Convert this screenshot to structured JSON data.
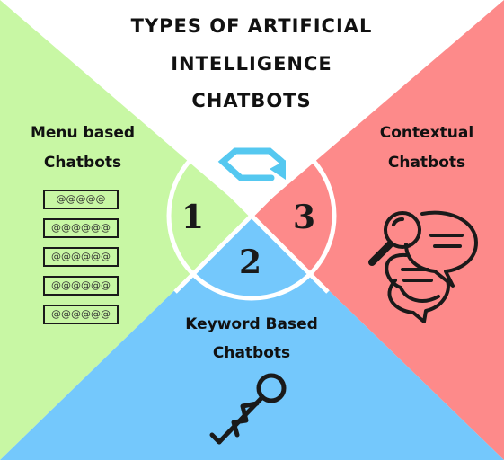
{
  "title_lines": [
    "TYPES OF ARTIFICIAL",
    "INTELLIGENCE",
    "CHATBOTS"
  ],
  "sections": {
    "menu": {
      "number": "1",
      "label_lines": [
        "Menu based",
        "Chatbots"
      ],
      "items": [
        "@@@@@",
        "@@@@@@",
        "@@@@@@",
        "@@@@@@",
        "@@@@@@"
      ],
      "color": "#c8f7a4"
    },
    "keyword": {
      "number": "2",
      "label_lines": [
        "Keyword Based",
        "Chatbots"
      ],
      "color": "#74c8fc"
    },
    "contextual": {
      "number": "3",
      "label_lines": [
        "Contextual",
        "Chatbots"
      ],
      "color": "#fd8a8a"
    }
  },
  "icons": [
    "refresh-arrow-icon",
    "chat-search-icon",
    "key-icon"
  ],
  "colors": {
    "top": "#ffffff",
    "dark": "#1a1a1a",
    "arrow": "#55c8f0"
  }
}
